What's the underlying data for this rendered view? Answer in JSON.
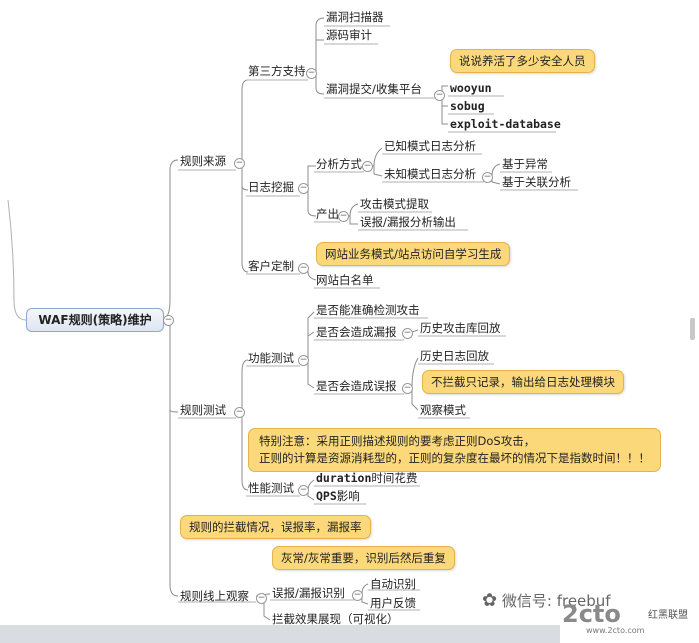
{
  "root": {
    "label": "WAF规则(策略)维护"
  },
  "branches": {
    "rule_source": {
      "label": "规则来源",
      "third_party": {
        "label": "第三方支持",
        "items": [
          "漏洞扫描器",
          "源码审计",
          "漏洞提交/收集平台"
        ],
        "callout": "说说养活了多少安全人员",
        "platforms": [
          "wooyun",
          "sobug",
          "exploit-database"
        ]
      },
      "log_mining": {
        "label": "日志挖掘",
        "analysis": {
          "label": "分析方式",
          "known": "已知模式日志分析",
          "unknown": "未知模式日志分析",
          "unknown_children": [
            "基于异常",
            "基于关联分析"
          ]
        },
        "output": {
          "label": "产出",
          "items": [
            "攻击模式提取",
            "误报/漏报分析输出"
          ]
        }
      },
      "custom": {
        "label": "客户定制",
        "callout": "网站业务模式/站点访问自学习生成",
        "item": "网站白名单"
      }
    },
    "rule_test": {
      "label": "规则测试",
      "function_test": {
        "label": "功能测试",
        "items": [
          "是否能准确检测攻击",
          "是否会造成漏报",
          "是否会造成误报"
        ],
        "miss_child": "历史攻击库回放",
        "false_children": [
          "历史日志回放",
          "观察模式"
        ],
        "false_callout": "不拦截只记录，输出给日志处理模块"
      },
      "perf_test": {
        "label": "性能测试",
        "callout_line1": "特别注意：采用正则描述规则的要考虑正则DoS攻击，",
        "callout_line2": "正则的计算是资源消耗型的，正则的复杂度在最坏的情况下是指数时间！！！",
        "duration_key": "duration",
        "duration_rest": "时间花费",
        "qps_key": "QPS",
        "qps_rest": "影响"
      }
    },
    "rule_online": {
      "label": "规则线上观察",
      "callout": "规则的拦截情况，误报率，漏报率",
      "fp": {
        "label": "误报/漏报识别",
        "callout": "灰常/灰常重要，识别后然后重复",
        "children": [
          "自动识别",
          "用户反馈"
        ]
      },
      "display": "拦截效果展现（可视化）"
    }
  },
  "watermark": {
    "wechat": "微信号: freebuf",
    "site": "2cto",
    "site_sub": "红黑联盟",
    "url": "www.2cto.com"
  },
  "colors": {
    "line": "#8c8c8c",
    "callout": "#fbd97a",
    "root_border": "#8fa8c8"
  }
}
